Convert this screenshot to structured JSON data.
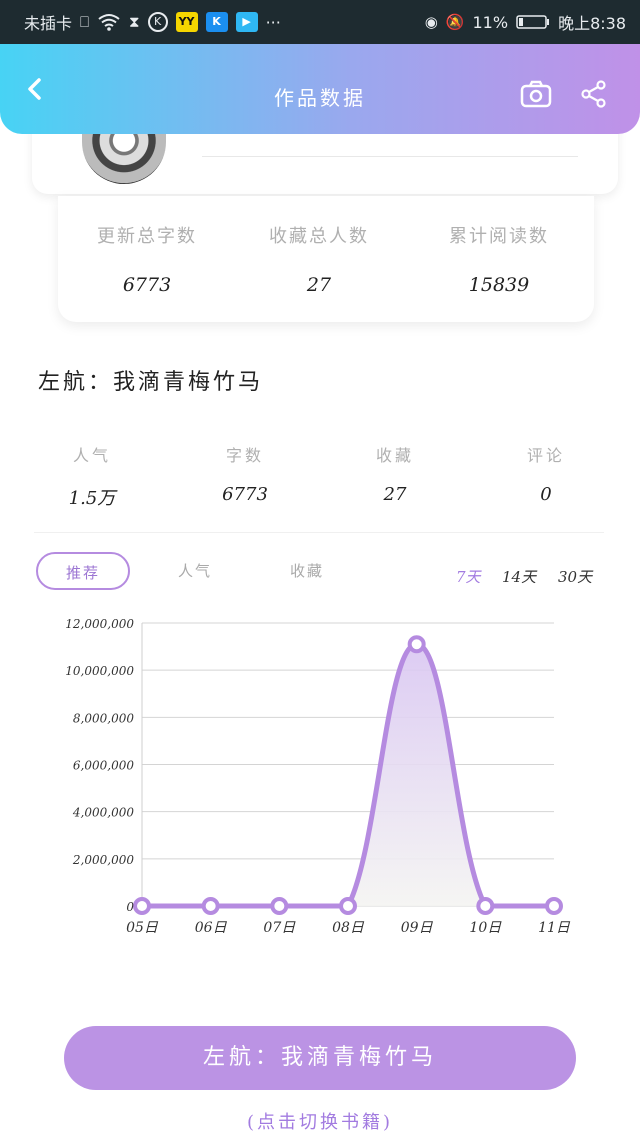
{
  "status_bar": {
    "carrier": "未插卡",
    "battery": "11%",
    "time": "晚上8:38",
    "icons": [
      "no-sim-alert-icon",
      "wifi-icon",
      "hourglass-icon",
      "k-circle-icon",
      "yy-app-icon",
      "k-app-icon",
      "tv-app-icon",
      "more-dots-icon",
      "eye-icon",
      "mute-bell-icon",
      "battery-icon"
    ],
    "yy_label": "YY",
    "k_label": "K",
    "more": "···"
  },
  "header": {
    "title": "作品数据",
    "accent_gradient": [
      "#47d3f4",
      "#c091e8"
    ]
  },
  "summary": {
    "update_words_label": "更新总字数",
    "update_words_value": "6773",
    "favorites_label": "收藏总人数",
    "favorites_value": "27",
    "reads_label": "累计阅读数",
    "reads_value": "15839"
  },
  "book": {
    "title": "左航：我滴青梅竹马"
  },
  "metrics": [
    {
      "label": "人气",
      "value": "1.5万"
    },
    {
      "label": "字数",
      "value": "6773"
    },
    {
      "label": "收藏",
      "value": "27"
    },
    {
      "label": "评论",
      "value": "0"
    }
  ],
  "tabs": [
    {
      "label": "推荐",
      "active": true
    },
    {
      "label": "人气",
      "active": false
    },
    {
      "label": "收藏",
      "active": false
    }
  ],
  "ranges": [
    {
      "label": "7天",
      "active": true
    },
    {
      "label": "14天",
      "active": false
    },
    {
      "label": "30天",
      "active": false
    }
  ],
  "chart_data": {
    "type": "area",
    "categories": [
      "05日",
      "06日",
      "07日",
      "08日",
      "09日",
      "10日",
      "11日"
    ],
    "values": [
      0,
      0,
      0,
      0,
      11100000,
      0,
      0
    ],
    "ylim": [
      0,
      12000000
    ],
    "yticks": [
      "0",
      "2,000,000",
      "4,000,000",
      "6,000,000",
      "8,000,000",
      "10,000,000",
      "12,000,000"
    ],
    "grid": true,
    "color": "#b58be0"
  },
  "cta": {
    "label": "左航：我滴青梅竹马",
    "hint": "(点击切换书籍)"
  }
}
